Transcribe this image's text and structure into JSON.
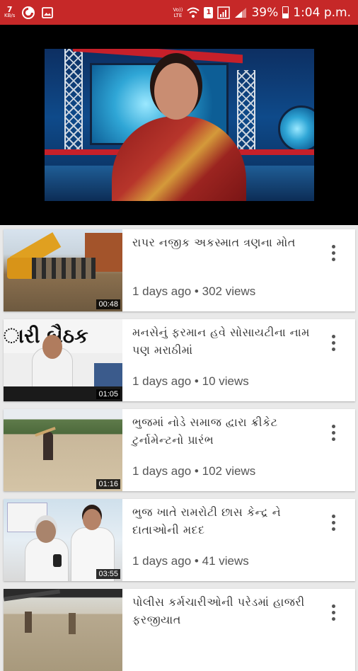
{
  "status_bar": {
    "speed_value": "7",
    "speed_unit": "KB/s",
    "volte_top": "Vo))",
    "volte_bottom": "LTE",
    "sim_label": "1",
    "battery": "39%",
    "time": "1:04 p.m.",
    "background": "#c62828"
  },
  "player": {
    "description_icon": "news-anchor-video"
  },
  "videos": [
    {
      "title": "રાપર નજીક અકસ્માત ત્રણના મોત",
      "age": "1 days ago",
      "views": "302 views",
      "separator": "•",
      "duration": "00:48"
    },
    {
      "title": "મનસેનું ફરમાન હવે સોસાયટીના નામ પણ મરાઠીમાં",
      "age": "1 days ago",
      "views": "10 views",
      "separator": "•",
      "duration": "01:05"
    },
    {
      "title": "ભુજમાં નોડે સમાજ દ્વારા ક્રીકેટ ટુર્નામેન્ટનો પ્રારંભ",
      "age": "1 days ago",
      "views": "102 views",
      "separator": "•",
      "duration": "01:16"
    },
    {
      "title": "ભુજ ખાતે રામરોટી છાસ કેન્દ્ર ને દાતાઓની મદદ",
      "age": "1 days ago",
      "views": "41 views",
      "separator": "•",
      "duration": "03:55"
    },
    {
      "title": "પોલીસ કર્મચારીઓની પરેડમાં હાજરી ફરજીયાત",
      "age": "",
      "views": "",
      "separator": "",
      "duration": ""
    }
  ],
  "thumb2_banner_text": "ારી બૈઠક"
}
